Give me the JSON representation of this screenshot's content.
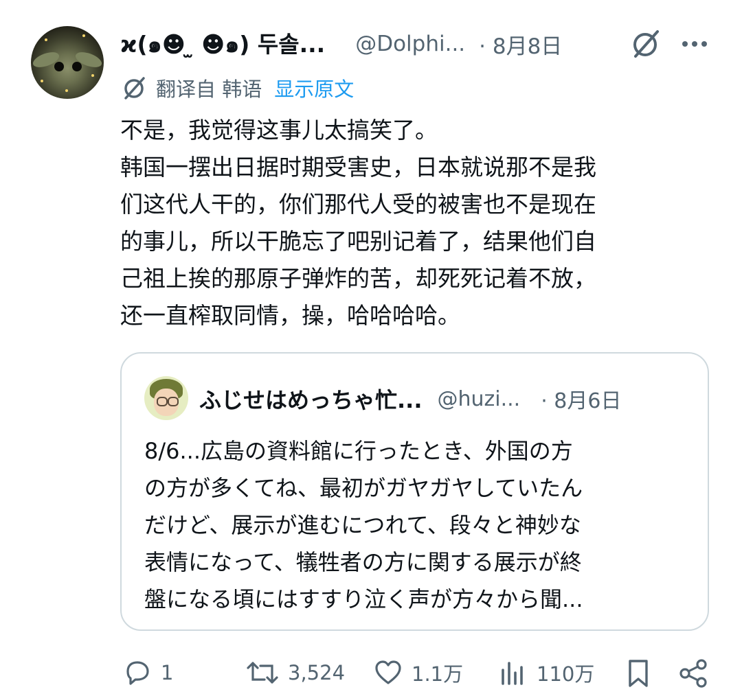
{
  "tweet": {
    "display_name": "ϰ(๑☻ ̫ ☻๑) 두솔...",
    "handle": "@Dolphi...",
    "date": "· 8月8日",
    "translate_label": "翻译自 韩语",
    "show_original": "显示原文",
    "body_lines": [
      "不是，我觉得这事儿太搞笑了。",
      "韩国一摆出日据时期受害史，日本就说那不是我",
      "们这代人干的，你们那代人受的被害也不是现在",
      "的事儿，所以干脆忘了吧别记着了，结果他们自",
      "己祖上挨的那原子弹炸的苦，却死死记着不放，",
      "还一直榨取同情，操，哈哈哈哈。"
    ]
  },
  "quoted": {
    "display_name": "ふじせはめっちゃ忙...",
    "handle": "@huzi...",
    "date": "· 8月6日",
    "body_lines": [
      "8/6...広島の資料館に行ったとき、外国の方",
      "の方が多くてね、最初がガヤガヤしていたん",
      "だけど、展示が進むにつれて、段々と神妙な",
      "表情になって、犠牲者の方に関する展示が終",
      "盤になる頃にはすすり泣く声が方々から聞..."
    ]
  },
  "actions": {
    "replies": "1",
    "reposts": "3,524",
    "likes": "1.1万",
    "views": "110万"
  },
  "icons": {
    "grok": "grok-icon",
    "more": "more-icon",
    "translate": "translate-icon",
    "reply": "reply-icon",
    "repost": "repost-icon",
    "like": "like-icon",
    "views": "views-icon",
    "bookmark": "bookmark-icon",
    "share": "share-icon"
  },
  "colors": {
    "text": "#0f1419",
    "secondary": "#536471",
    "link": "#1d9bf0",
    "border": "#cfd9de"
  }
}
